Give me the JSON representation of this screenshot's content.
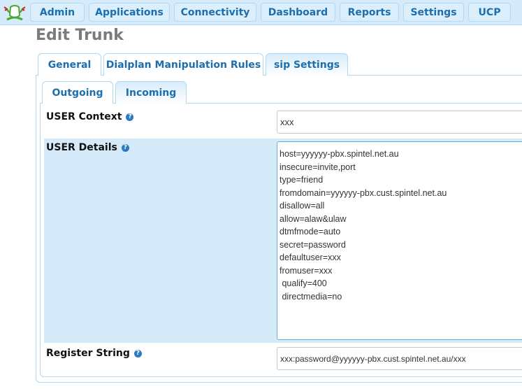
{
  "nav": {
    "logo_icon": "frog-logo-icon",
    "items": [
      {
        "label": "Admin"
      },
      {
        "label": "Applications"
      },
      {
        "label": "Connectivity"
      },
      {
        "label": "Dashboard"
      },
      {
        "label": "Reports"
      },
      {
        "label": "Settings"
      },
      {
        "label": "UCP"
      }
    ]
  },
  "page_title": "Edit Trunk",
  "tabs": [
    {
      "label": "General",
      "active": false
    },
    {
      "label": "Dialplan Manipulation Rules",
      "active": false
    },
    {
      "label": "sip Settings",
      "active": true
    }
  ],
  "subtabs": [
    {
      "label": "Outgoing",
      "active": false
    },
    {
      "label": "Incoming",
      "active": true
    }
  ],
  "form": {
    "user_context": {
      "label": "USER Context",
      "value": "xxx",
      "help_icon": "question-circle-icon"
    },
    "user_details": {
      "label": "USER Details",
      "help_icon": "question-circle-icon",
      "lines": [
        "host=yyyyyy-pbx.spintel.net.au",
        "insecure=invite,port",
        "type=friend",
        "fromdomain=yyyyyy-pbx.cust.spintel.net.au",
        "disallow=all",
        "allow=alaw&ulaw",
        "dtmfmode=auto",
        "secret=password",
        "defaultuser=xxx",
        "fromuser=xxx",
        " qualify=400",
        " directmedia=no"
      ]
    },
    "register_string": {
      "label": "Register String",
      "value": "xxx:password@yyyyyy-pbx.cust.spintel.net.au/xxx",
      "help_icon": "question-circle-icon"
    }
  }
}
